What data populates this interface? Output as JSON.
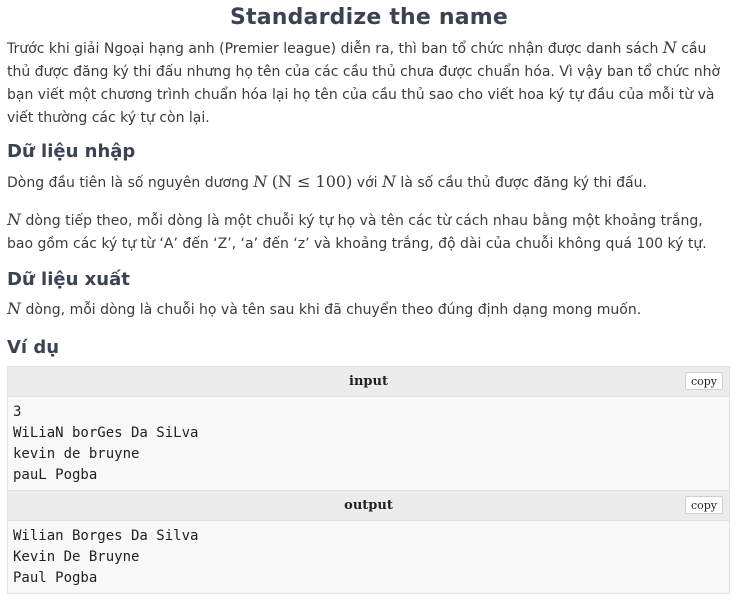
{
  "title": "Standardize the name",
  "intro": {
    "part1": "Trước khi giải Ngoại hạng anh (Premier league) diễn ra, thì ban tổ chức nhận được danh sách ",
    "var_n": "N",
    "part2": " cầu thủ được đăng ký thi đấu nhưng họ tên của các cầu thủ chưa được chuẩn hóa. Vì vậy ban tổ chức nhờ bạn viết một chương trình chuẩn hóa lại họ tên của cầu thủ sao cho viết hoa ký tự đầu của mỗi từ và viết thường các ký tự còn lại."
  },
  "input_section": {
    "heading": "Dữ liệu nhập",
    "line1_part1": "Dòng đầu tiên là số nguyên dương ",
    "line1_var": "N",
    "line1_math": "(N ≤ 100)",
    "line1_part2": " với ",
    "line1_var2": "N",
    "line1_part3": " là số cầu thủ được đăng ký thi đấu.",
    "line2_var": "N",
    "line2_text": " dòng tiếp theo, mỗi dòng là một chuỗi ký tự họ và tên các từ cách nhau bằng một khoảng trắng, bao gồm các ký tự từ ‘A’ đến ‘Z’, ‘a’ đến ‘z’ và khoảng trắng, độ dài của chuỗi không quá 100 ký tự."
  },
  "output_section": {
    "heading": "Dữ liệu xuất",
    "var": "N",
    "text": " dòng, mỗi dòng là chuỗi họ và tên sau khi đã chuyển theo đúng định dạng mong muốn."
  },
  "example": {
    "heading": "Ví dụ",
    "input_title": "input",
    "output_title": "output",
    "copy_label": "copy",
    "input_lines": [
      "3",
      "WiLiaN borGes Da SiLva",
      "kevin de bruyne",
      "pauL Pogba"
    ],
    "output_lines": [
      "Wilian Borges Da Silva",
      "Kevin De Bruyne",
      "Paul Pogba"
    ]
  }
}
